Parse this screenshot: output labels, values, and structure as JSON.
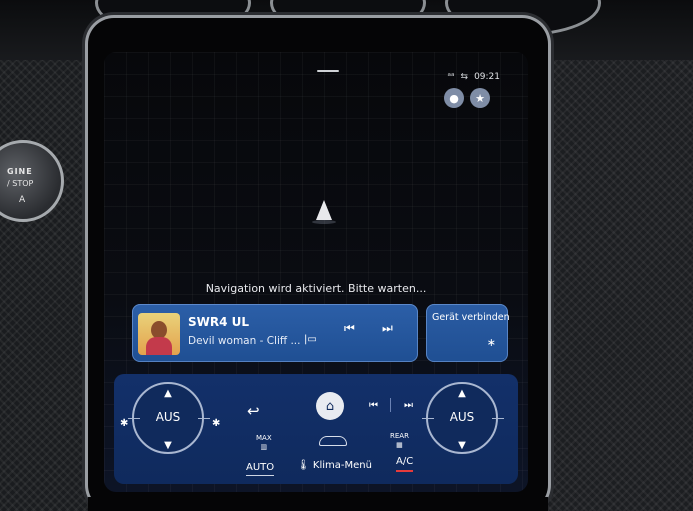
{
  "status_bar": {
    "signal_icon": "signal-icon",
    "phone_icon": "phone-signal-icon",
    "time": "09:21"
  },
  "top_buttons": {
    "profile_icon": "profile-icon",
    "favorites_icon": "star-icon"
  },
  "navigation": {
    "message": "Navigation wird aktiviert. Bitte warten..."
  },
  "media": {
    "station": "SWR4 UL",
    "track": "Devil woman - Cliff ...",
    "source_icon": "radio-source-icon",
    "prev_icon": "skip-previous-icon",
    "next_icon": "skip-next-icon"
  },
  "connect": {
    "label": "Gerät verbinden",
    "icon": "bluetooth-icon"
  },
  "climate": {
    "left_temp": "AUS",
    "right_temp": "AUS",
    "auto_label": "AUTO",
    "klima_label": "Klima-Menü",
    "ac_label": "A/C",
    "max_label": "MAX",
    "rear_label": "REAR",
    "accent_ac": "#e53b3b"
  },
  "hardware": {
    "start_line1": "GINE",
    "start_line2": "/ STOP",
    "start_line3": "A"
  }
}
